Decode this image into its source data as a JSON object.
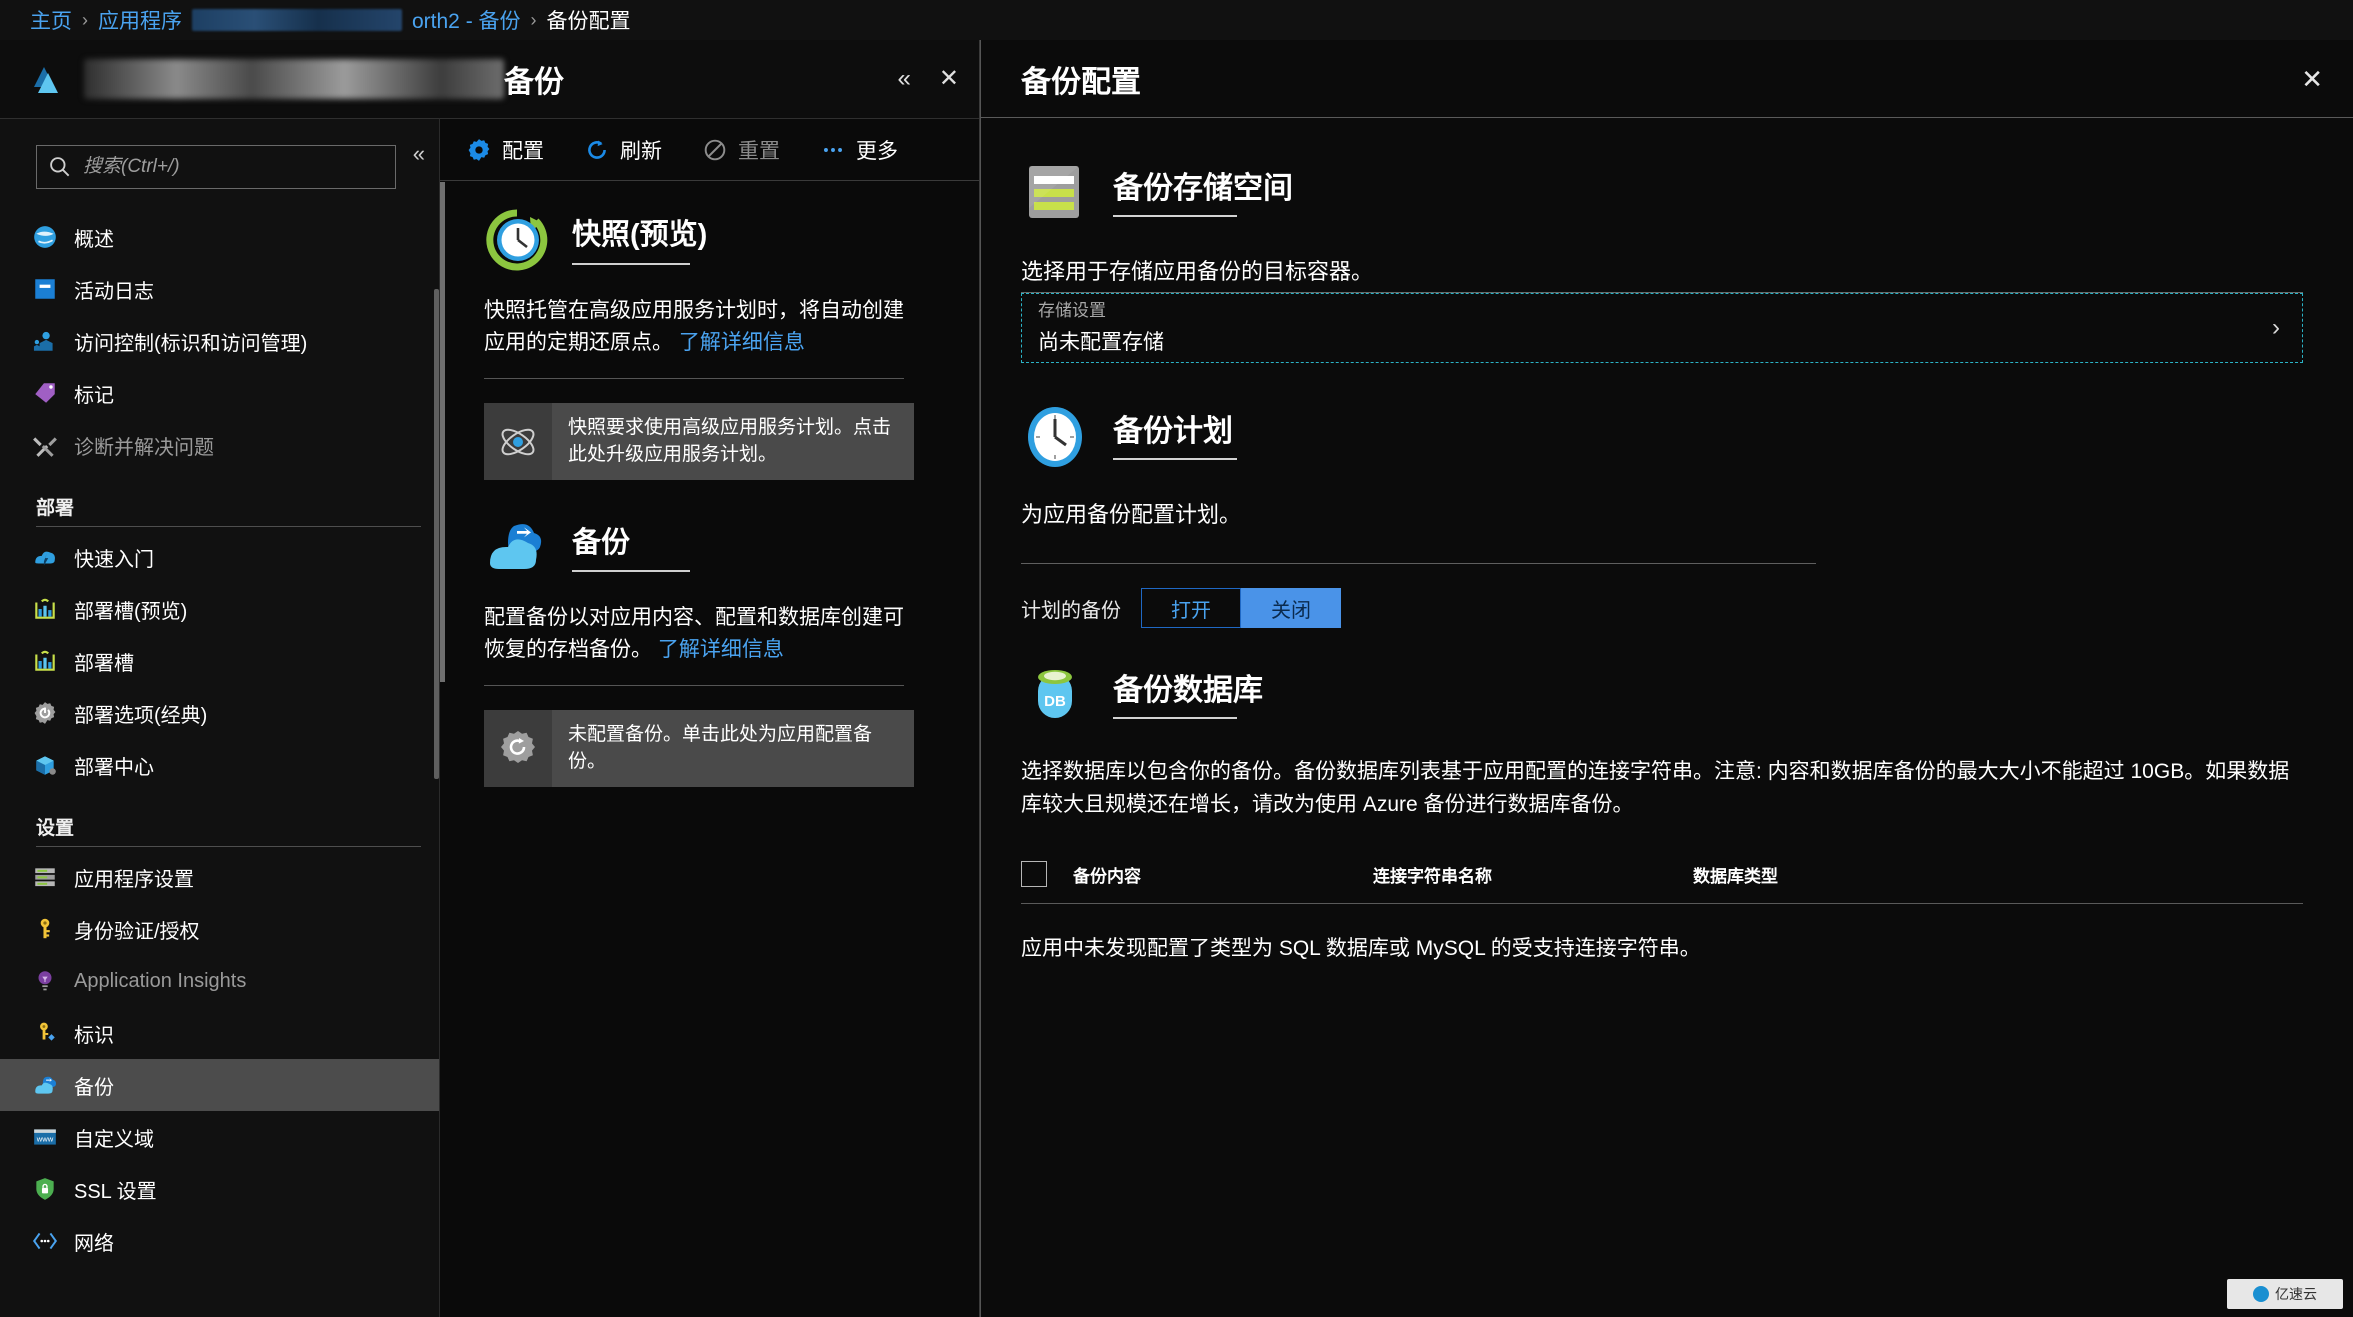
{
  "breadcrumb": {
    "home": "主页",
    "item_app": "应用程序",
    "item_tail": "orth2 - 备份",
    "current": "备份配置",
    "separator": "›"
  },
  "blade": {
    "title": "备份",
    "collapse_glyph": "«",
    "close_glyph": "✕"
  },
  "sidebar": {
    "search_placeholder": "搜索(Ctrl+/)",
    "search_value": "",
    "collapse_glyph": "«",
    "items_top": [
      {
        "label": "概述",
        "icon": "overview-icon",
        "disabled": false
      },
      {
        "label": "活动日志",
        "icon": "activity-log-icon",
        "disabled": false
      },
      {
        "label": "访问控制(标识和访问管理)",
        "icon": "access-control-icon",
        "disabled": false
      },
      {
        "label": "标记",
        "icon": "tag-icon",
        "disabled": false
      },
      {
        "label": "诊断并解决问题",
        "icon": "diagnose-icon",
        "disabled": true
      }
    ],
    "group_deploy": "部署",
    "items_deploy": [
      {
        "label": "快速入门",
        "icon": "quickstart-icon",
        "disabled": false
      },
      {
        "label": "部署槽(预览)",
        "icon": "deployment-slot-icon",
        "disabled": false
      },
      {
        "label": "部署槽",
        "icon": "deployment-slot-icon",
        "disabled": false
      },
      {
        "label": "部署选项(经典)",
        "icon": "deployment-options-icon",
        "disabled": false
      },
      {
        "label": "部署中心",
        "icon": "deployment-center-icon",
        "disabled": false
      }
    ],
    "group_settings": "设置",
    "items_settings": [
      {
        "label": "应用程序设置",
        "icon": "app-settings-icon",
        "disabled": false,
        "selected": false
      },
      {
        "label": "身份验证/授权",
        "icon": "auth-key-icon",
        "disabled": false,
        "selected": false
      },
      {
        "label": "Application Insights",
        "icon": "app-insights-icon",
        "disabled": true,
        "selected": false
      },
      {
        "label": "标识",
        "icon": "identity-icon",
        "disabled": false,
        "selected": false
      },
      {
        "label": "备份",
        "icon": "backup-cloud-icon",
        "disabled": false,
        "selected": true
      },
      {
        "label": "自定义域",
        "icon": "custom-domain-icon",
        "disabled": false,
        "selected": false
      },
      {
        "label": "SSL 设置",
        "icon": "ssl-shield-icon",
        "disabled": false,
        "selected": false
      },
      {
        "label": "网络",
        "icon": "network-icon",
        "disabled": false,
        "selected": false
      }
    ]
  },
  "toolbar": {
    "configure": "配置",
    "refresh": "刷新",
    "reset": "重置",
    "more": "更多"
  },
  "middle": {
    "snapshot": {
      "title": "快照(预览)",
      "desc": "快照托管在高级应用服务计划时，将自动创建应用的定期还原点。",
      "link": "了解详细信息",
      "notice": "快照要求使用高级应用服务计划。点击此处升级应用服务计划。"
    },
    "backup": {
      "title": "备份",
      "desc": "配置备份以对应用内容、配置和数据库创建可恢复的存档备份。",
      "link": "了解详细信息",
      "notice": "未配置备份。单击此处为应用配置备份。"
    }
  },
  "right": {
    "title": "备份配置",
    "close_glyph": "✕",
    "storage": {
      "title": "备份存储空间",
      "desc": "选择用于存储应用备份的目标容器。",
      "picker_label": "存储设置",
      "picker_value": "尚未配置存储",
      "chevron": "›"
    },
    "schedule": {
      "title": "备份计划",
      "desc": "为应用备份配置计划。",
      "row_label": "计划的备份",
      "on_label": "打开",
      "off_label": "关闭",
      "selected": "关闭"
    },
    "database": {
      "title": "备份数据库",
      "desc": "选择数据库以包含你的备份。备份数据库列表基于应用配置的连接字符串。注意: 内容和数据库备份的最大大小不能超过 10GB。如果数据库较大且规模还在增长，请改为使用 Azure 备份进行数据库备份。",
      "columns": [
        "备份内容",
        "连接字符串名称",
        "数据库类型"
      ],
      "empty_message": "应用中未发现配置了类型为 SQL 数据库或 MySQL 的受支持连接字符串。"
    }
  },
  "watermark": {
    "text": "亿速云"
  },
  "colors": {
    "accent_blue": "#4aa3f0",
    "selected_bg": "#4c4c4c",
    "toggle_active": "#4a93e8",
    "dashed_border": "#2bb3c6"
  }
}
